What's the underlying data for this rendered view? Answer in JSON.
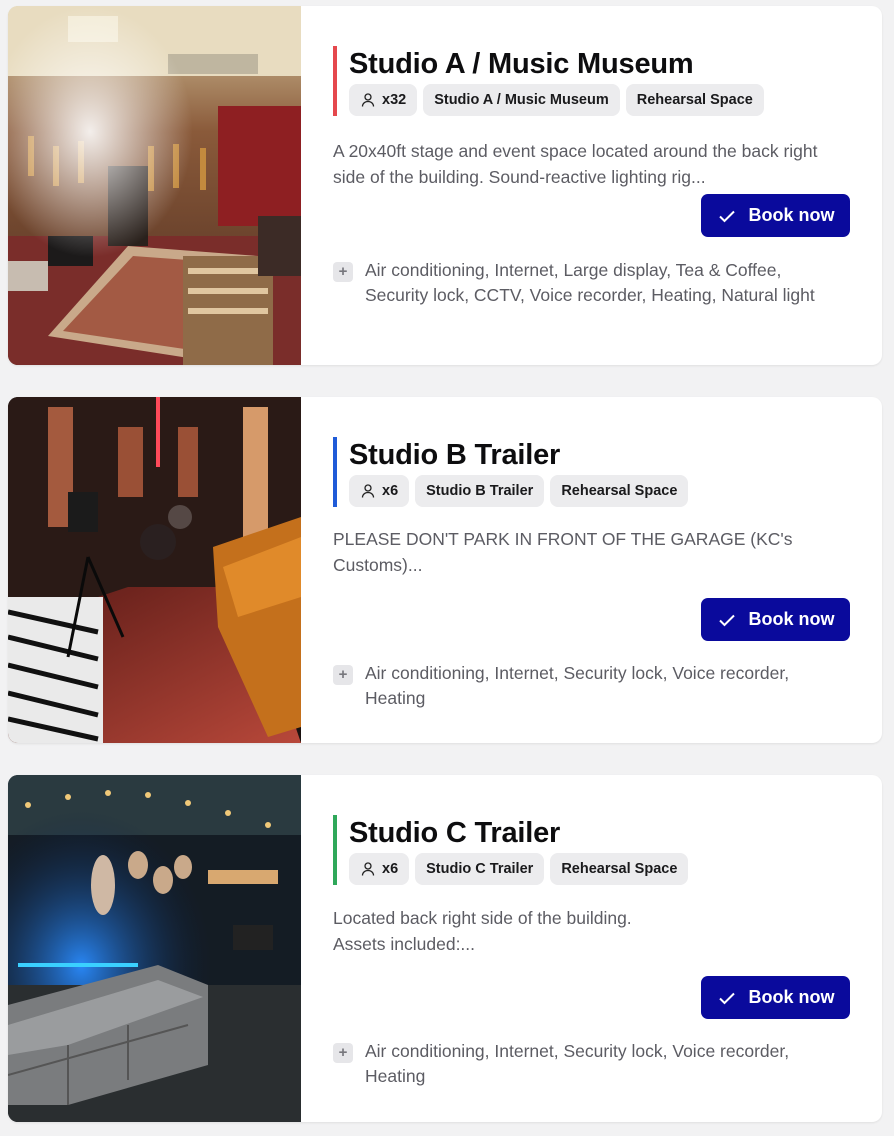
{
  "rooms": [
    {
      "title": "Studio A / Music Museum",
      "accent": "#e5484d",
      "capacity": "x32",
      "tags": [
        "Studio A / Music Museum",
        "Rehearsal Space"
      ],
      "description": "A 20x40ft stage and event space located around the back right side of the building. Sound-reactive lighting rig...",
      "book_label": "Book now",
      "amenities": "Air conditioning, Internet, Large display, Tea & Coffee, Security lock, CCTV, Voice recorder, Heating, Natural light",
      "icons": {
        "capacity": "person-icon",
        "book": "check-icon",
        "amenities": "plus-icon"
      }
    },
    {
      "title": "Studio B Trailer",
      "accent": "#1f5bd8",
      "capacity": "x6",
      "tags": [
        "Studio B Trailer",
        "Rehearsal Space"
      ],
      "description": "PLEASE DON'T PARK IN FRONT OF THE GARAGE (KC's Customs)...",
      "book_label": "Book now",
      "amenities": "Air conditioning, Internet, Security lock, Voice recorder, Heating",
      "icons": {
        "capacity": "person-icon",
        "book": "check-icon",
        "amenities": "plus-icon"
      }
    },
    {
      "title": "Studio C Trailer",
      "accent": "#2fa85a",
      "capacity": "x6",
      "tags": [
        "Studio C Trailer",
        "Rehearsal Space"
      ],
      "description": "Located back right side of the building.\nAssets included:...",
      "book_label": "Book now",
      "amenities": "Air conditioning, Internet, Security lock, Voice recorder, Heating",
      "icons": {
        "capacity": "person-icon",
        "book": "check-icon",
        "amenities": "plus-icon"
      }
    }
  ],
  "colors": {
    "page_bg": "#f2f2f3",
    "button": "#0a0a9c",
    "tag_bg": "#ececee",
    "muted_text": "#5c5c63"
  }
}
